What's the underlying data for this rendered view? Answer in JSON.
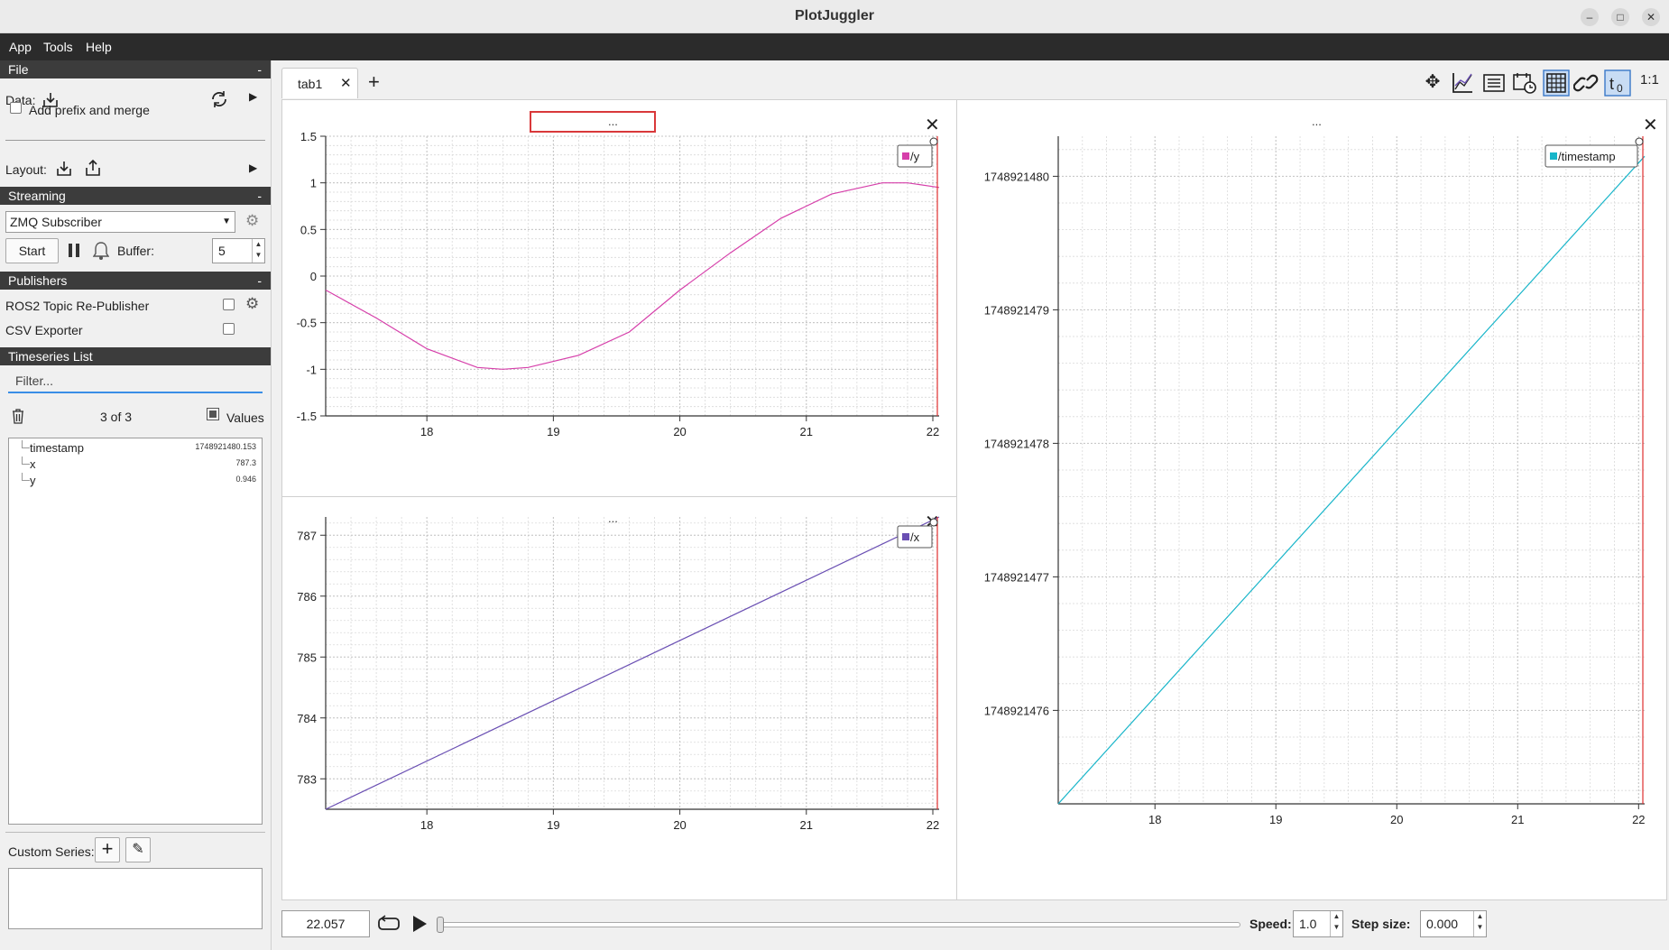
{
  "window": {
    "title": "PlotJuggler"
  },
  "menu": [
    "App",
    "Tools",
    "Help"
  ],
  "file": {
    "header": "File",
    "data_label": "Data:",
    "add_prefix": "Add prefix and merge",
    "layout_label": "Layout:"
  },
  "streaming": {
    "header": "Streaming",
    "source": "ZMQ Subscriber",
    "start": "Start",
    "buffer_label": "Buffer:",
    "buffer_value": "5"
  },
  "publishers": {
    "header": "Publishers",
    "items": [
      "ROS2 Topic Re-Publisher",
      "CSV Exporter"
    ]
  },
  "timeseries": {
    "header": "Timeseries List",
    "filter_placeholder": "Filter...",
    "count": "3 of 3",
    "values_label": "Values",
    "items": [
      {
        "name": "timestamp",
        "value": "1748921480.153"
      },
      {
        "name": "x",
        "value": "787.3"
      },
      {
        "name": "y",
        "value": "0.946"
      }
    ],
    "custom_series_label": "Custom Series:"
  },
  "tabs": {
    "active": "tab1",
    "add": "+"
  },
  "toolbar": {
    "ratio_label": "1:1"
  },
  "playback": {
    "time": "22.057",
    "speed_label": "Speed:",
    "speed": "1.0",
    "step_label": "Step size:",
    "step": "0.000"
  },
  "colors": {
    "y": "#d63faa",
    "x": "#6a4fb3",
    "timestamp": "#17b5c9",
    "cursor": "#e03030"
  },
  "chart_data": [
    {
      "type": "line",
      "title": "...",
      "legend": "/y",
      "legend_placement": "top-right",
      "xlim": [
        17.2,
        22.05
      ],
      "ylim": [
        -1.5,
        1.5
      ],
      "x_ticks": [
        "18",
        "19",
        "20",
        "21",
        "22"
      ],
      "y_ticks": [
        "1.5",
        "1",
        "0.5",
        "0",
        "-0.5",
        "-1",
        "-1.5"
      ],
      "grid": true,
      "series": [
        {
          "name": "/y",
          "x": [
            17.2,
            17.6,
            18.0,
            18.4,
            18.6,
            18.8,
            19.2,
            19.6,
            20.0,
            20.4,
            20.8,
            21.2,
            21.6,
            21.8,
            22.05
          ],
          "y": [
            -0.15,
            -0.45,
            -0.78,
            -0.98,
            -1.0,
            -0.98,
            -0.85,
            -0.6,
            -0.15,
            0.25,
            0.62,
            0.88,
            1.0,
            1.0,
            0.95
          ]
        }
      ]
    },
    {
      "type": "line",
      "title": "...",
      "legend": "/x",
      "legend_placement": "top-right",
      "xlim": [
        17.2,
        22.05
      ],
      "ylim": [
        782.5,
        787.3
      ],
      "x_ticks": [
        "18",
        "19",
        "20",
        "21",
        "22"
      ],
      "y_ticks": [
        "787",
        "786",
        "785",
        "784",
        "783"
      ],
      "grid": true,
      "series": [
        {
          "name": "/x",
          "x": [
            17.2,
            22.05
          ],
          "y": [
            782.5,
            787.3
          ]
        }
      ]
    },
    {
      "type": "line",
      "title": "...",
      "legend": "/timestamp",
      "legend_placement": "top-right",
      "xlim": [
        17.2,
        22.05
      ],
      "ylim": [
        1748921475.3,
        1748921480.3
      ],
      "x_ticks": [
        "18",
        "19",
        "20",
        "21",
        "22"
      ],
      "y_ticks": [
        "1748921480",
        "1748921479",
        "1748921478",
        "1748921477",
        "1748921476"
      ],
      "grid": true,
      "series": [
        {
          "name": "/timestamp",
          "x": [
            17.2,
            22.05
          ],
          "y": [
            1748921475.3,
            1748921480.15
          ]
        }
      ]
    }
  ]
}
